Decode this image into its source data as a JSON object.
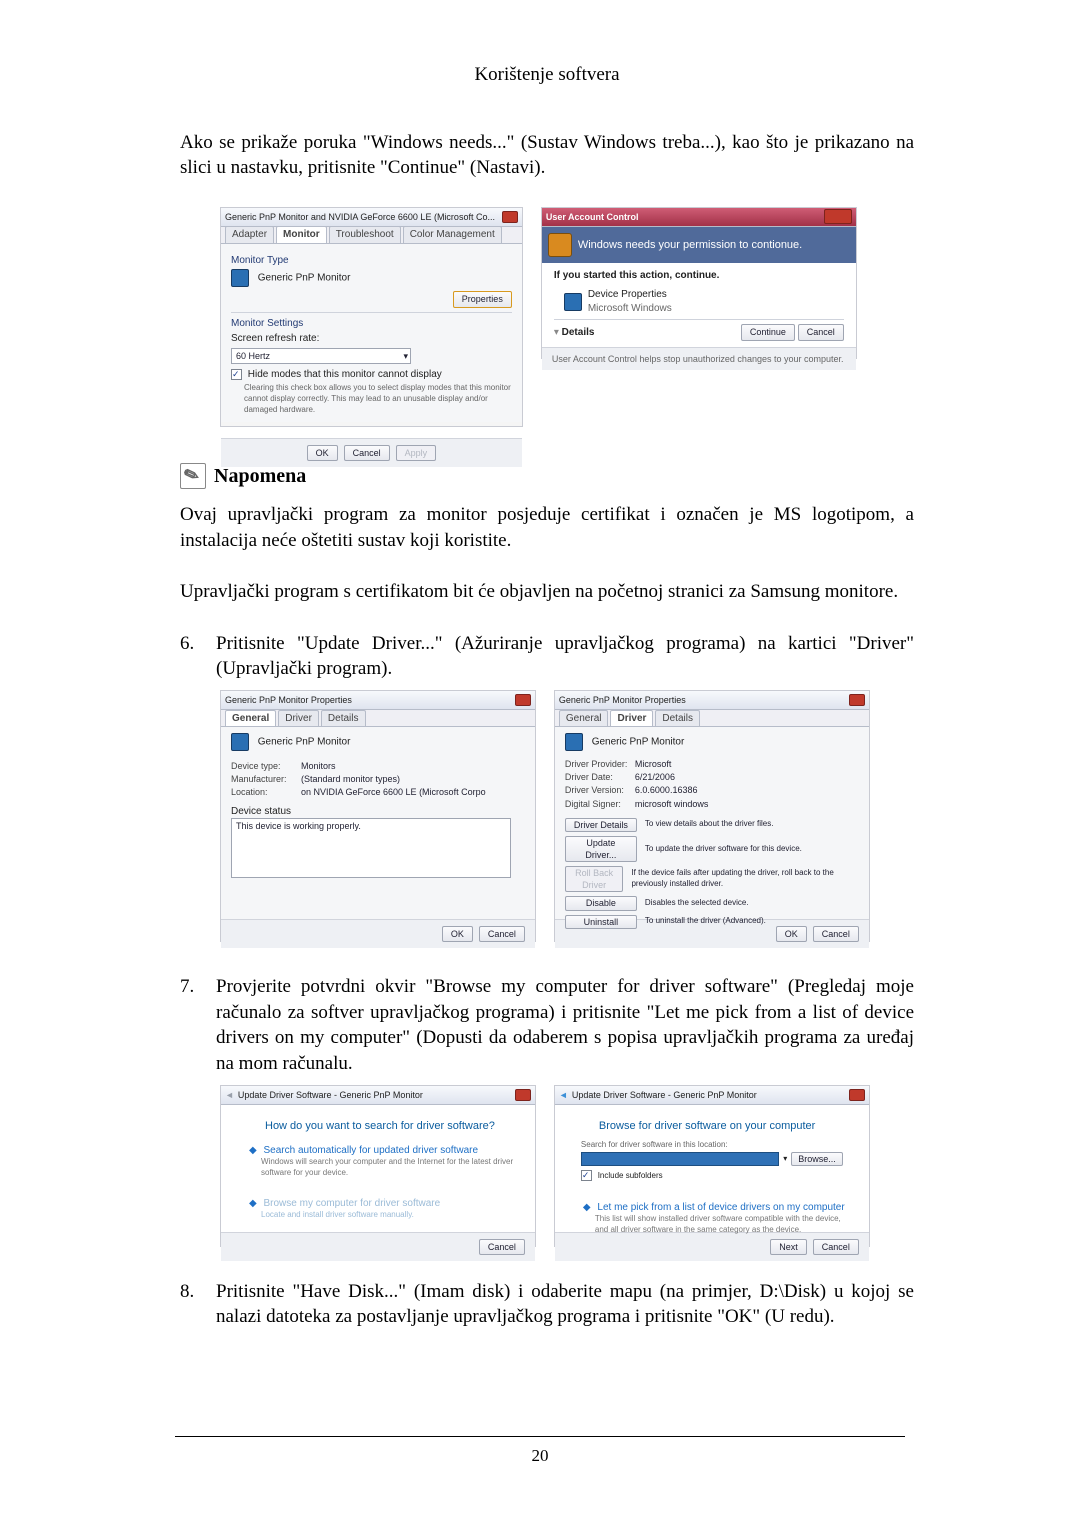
{
  "header_title": "Korištenje softvera",
  "intro_para": "Ako se prikaže poruka \"Windows needs...\" (Sustav Windows treba...), kao što je prikazano na slici u nastavku, pritisnite \"Continue\" (Nastavi).",
  "fig1": {
    "title": "Generic PnP Monitor and NVIDIA GeForce 6600 LE (Microsoft Co...",
    "tabs": {
      "adapter": "Adapter",
      "monitor": "Monitor",
      "troubleshoot": "Troubleshoot",
      "color": "Color Management"
    },
    "monitor_type_label": "Monitor Type",
    "monitor_type_value": "Generic PnP Monitor",
    "properties_btn": "Properties",
    "monitor_settings_label": "Monitor Settings",
    "refresh_label": "Screen refresh rate:",
    "refresh_value": "60 Hertz",
    "hide_modes": "Hide modes that this monitor cannot display",
    "hide_note": "Clearing this check box allows you to select display modes that this monitor cannot display correctly. This may lead to an unusable display and/or damaged hardware.",
    "ok": "OK",
    "cancel": "Cancel",
    "apply": "Apply"
  },
  "fig2": {
    "title": "User Account Control",
    "headline": "Windows needs your permission to contionue.",
    "if_started": "If you started this action, continue.",
    "dev_props": "Device Properties",
    "ms": "Microsoft Windows",
    "details": "Details",
    "continue": "Continue",
    "cancel": "Cancel",
    "footer": "User Account Control helps stop unauthorized changes to your computer."
  },
  "note_heading": "Napomena",
  "note_para1": "Ovaj upravljački program za monitor posjeduje certifikat i označen je MS logotipom, a instalacija neće oštetiti sustav koji koristite.",
  "note_para2": "Upravljački program s certifikatom bit će objavljen na početnoj stranici za Samsung monitore.",
  "step6_num": "6.",
  "step6_text": "Pritisnite \"Update Driver...\" (Ažuriranje upravljačkog programa) na kartici \"Driver\" (Upravljački program).",
  "fig3": {
    "title": "Generic PnP Monitor Properties",
    "tabs": {
      "general": "General",
      "driver": "Driver",
      "details": "Details"
    },
    "device": "Generic PnP Monitor",
    "kv": {
      "device_type_k": "Device type:",
      "device_type_v": "Monitors",
      "manuf_k": "Manufacturer:",
      "manuf_v": "(Standard monitor types)",
      "loc_k": "Location:",
      "loc_v": "on NVIDIA GeForce 6600 LE (Microsoft Corpo"
    },
    "status_label": "Device status",
    "status_text": "This device is working properly.",
    "ok": "OK",
    "cancel": "Cancel"
  },
  "fig4": {
    "title": "Generic PnP Monitor Properties",
    "tabs": {
      "general": "General",
      "driver": "Driver",
      "details": "Details"
    },
    "device": "Generic PnP Monitor",
    "kv": {
      "prov_k": "Driver Provider:",
      "prov_v": "Microsoft",
      "date_k": "Driver Date:",
      "date_v": "6/21/2006",
      "ver_k": "Driver Version:",
      "ver_v": "6.0.6000.16386",
      "sign_k": "Digital Signer:",
      "sign_v": "microsoft windows"
    },
    "buttons": {
      "details": "Driver Details",
      "details_d": "To view details about the driver files.",
      "update": "Update Driver...",
      "update_d": "To update the driver software for this device.",
      "rollback": "Roll Back Driver",
      "rollback_d": "If the device fails after updating the driver, roll back to the previously installed driver.",
      "disable": "Disable",
      "disable_d": "Disables the selected device.",
      "uninstall": "Uninstall",
      "uninstall_d": "To uninstall the driver (Advanced)."
    },
    "ok": "OK",
    "cancel": "Cancel"
  },
  "step7_num": "7.",
  "step7_text": "Provjerite potvrdni okvir \"Browse my computer for driver software\" (Pregledaj moje računalo za softver upravljačkog programa) i pritisnite \"Let me pick from a list of device drivers on my computer\" (Dopusti da odaberem s popisa upravljačkih programa za uređaj na mom računalu.",
  "fig5": {
    "title": "Update Driver Software - Generic PnP Monitor",
    "headline": "How do you want to search for driver software?",
    "opt1": "Search automatically for updated driver software",
    "opt1_d": "Windows will search your computer and the Internet for the latest driver software for your device.",
    "opt2": "Browse my computer for driver software",
    "opt2_d": "Locate and install driver software manually.",
    "cancel": "Cancel"
  },
  "fig6": {
    "title": "Update Driver Software - Generic PnP Monitor",
    "headline": "Browse for driver software on your computer",
    "search_label": "Search for driver software in this location:",
    "browse": "Browse...",
    "include": "Include subfolders",
    "letme": "Let me pick from a list of device drivers on my computer",
    "letme_d": "This list will show installed driver software compatible with the device, and all driver software in the same category as the device.",
    "next": "Next",
    "cancel": "Cancel"
  },
  "step8_num": "8.",
  "step8_text": "Pritisnite \"Have Disk...\" (Imam disk) i odaberite mapu (na primjer, D:\\Disk) u kojoj se nalazi datoteka za postavljanje upravljačkog programa i pritisnite \"OK\" (U redu).",
  "page_number": "20"
}
